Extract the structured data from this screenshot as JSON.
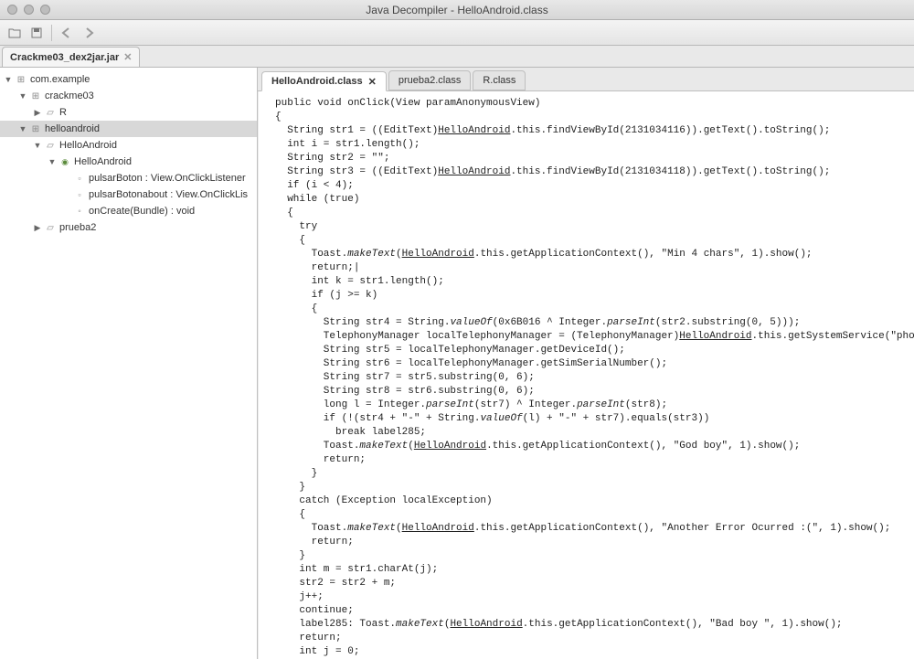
{
  "window": {
    "title": "Java Decompiler - HelloAndroid.class"
  },
  "fileTabs": [
    {
      "label": "Crackme03_dex2jar.jar"
    }
  ],
  "tree": [
    {
      "ind": 0,
      "arrow": "▼",
      "icon": "pkg",
      "label": "com.example"
    },
    {
      "ind": 1,
      "arrow": "▼",
      "icon": "pkg",
      "label": "crackme03"
    },
    {
      "ind": 2,
      "arrow": "▶",
      "icon": "file",
      "label": "R"
    },
    {
      "ind": 1,
      "arrow": "▼",
      "icon": "pkg",
      "label": "helloandroid",
      "selected": true
    },
    {
      "ind": 2,
      "arrow": "▼",
      "icon": "file",
      "label": "HelloAndroid"
    },
    {
      "ind": 3,
      "arrow": "▼",
      "icon": "class-inner",
      "label": "HelloAndroid"
    },
    {
      "ind": 4,
      "arrow": "",
      "icon": "field",
      "label": "pulsarBoton : View.OnClickListener"
    },
    {
      "ind": 4,
      "arrow": "",
      "icon": "field",
      "label": "pulsarBotonabout : View.OnClickLis"
    },
    {
      "ind": 4,
      "arrow": "",
      "icon": "method",
      "label": "onCreate(Bundle) : void"
    },
    {
      "ind": 2,
      "arrow": "▶",
      "icon": "file",
      "label": "prueba2"
    }
  ],
  "classTabs": [
    {
      "label": "HelloAndroid.class",
      "active": true,
      "closable": true
    },
    {
      "label": "prueba2.class",
      "active": false,
      "closable": false
    },
    {
      "label": "R.class",
      "active": false,
      "closable": false
    }
  ],
  "code": "public void onClick(View paramAnonymousView)\n{\n  String str1 = ((EditText)§HelloAndroid§.this.findViewById(2131034116)).getText().toString();\n  int i = str1.length();\n  String str2 = \"\";\n  String str3 = ((EditText)§HelloAndroid§.this.findViewById(2131034118)).getText().toString();\n  if (i < 4);\n  while (true)\n  {\n    try\n    {\n      Toast.~makeText~(§HelloAndroid§.this.getApplicationContext(), \"Min 4 chars\", 1).show();\n      return;|\n      int k = str1.length();\n      if (j >= k)\n      {\n        String str4 = String.~valueOf~(0x6B016 ^ Integer.~parseInt~(str2.substring(0, 5)));\n        TelephonyManager localTelephonyManager = (TelephonyManager)§HelloAndroid§.this.getSystemService(\"phone\");\n        String str5 = localTelephonyManager.getDeviceId();\n        String str6 = localTelephonyManager.getSimSerialNumber();\n        String str7 = str5.substring(0, 6);\n        String str8 = str6.substring(0, 6);\n        long l = Integer.~parseInt~(str7) ^ Integer.~parseInt~(str8);\n        if (!(str4 + \"-\" + String.~valueOf~(l) + \"-\" + str7).equals(str3))\n          break label285;\n        Toast.~makeText~(§HelloAndroid§.this.getApplicationContext(), \"God boy\", 1).show();\n        return;\n      }\n    }\n    catch (Exception localException)\n    {\n      Toast.~makeText~(§HelloAndroid§.this.getApplicationContext(), \"Another Error Ocurred :(\", 1).show();\n      return;\n    }\n    int m = str1.charAt(j);\n    str2 = str2 + m;\n    j++;\n    continue;\n    label285: Toast.~makeText~(§HelloAndroid§.this.getApplicationContext(), \"Bad boy \", 1).show();\n    return;\n    int j = 0;\n  }\n}\n}"
}
